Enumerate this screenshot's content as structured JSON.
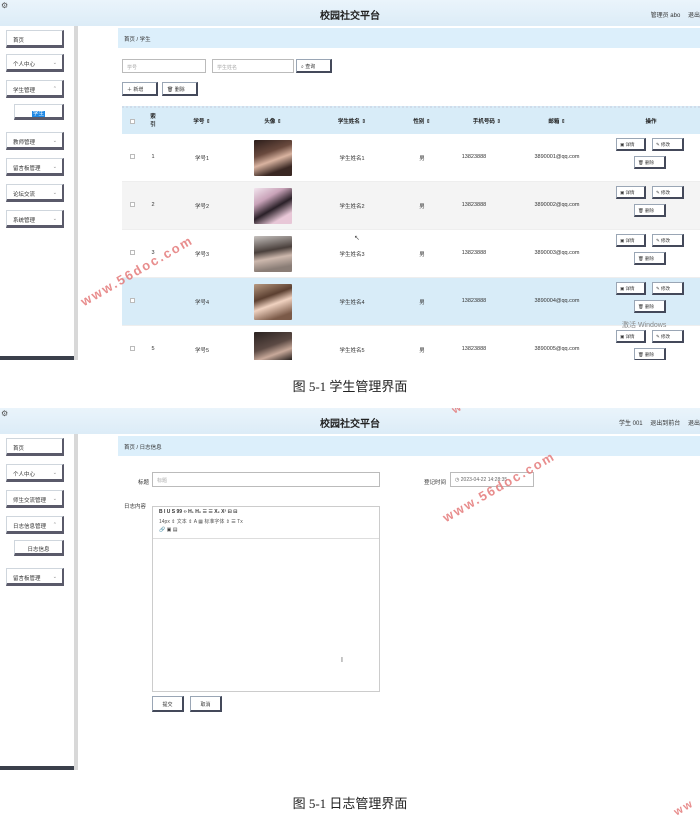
{
  "screen1": {
    "app_title": "校园社交平台",
    "user_label": "管理员 abo",
    "logout_label": "退出",
    "sidebar": [
      {
        "label": "首页",
        "chev": ""
      },
      {
        "label": "个人中心",
        "chev": "⌄"
      },
      {
        "label": "学生管理",
        "chev": "⌃"
      },
      {
        "label": "教师管理",
        "chev": "⌄"
      },
      {
        "label": "留言板管理",
        "chev": "⌄"
      },
      {
        "label": "论坛交流",
        "chev": "⌄"
      },
      {
        "label": "系统管理",
        "chev": "⌄"
      }
    ],
    "sidebar_sub": "学生",
    "breadcrumb": "首页 / 学生",
    "search": {
      "id_placeholder": "学号",
      "name_placeholder": "学生姓名",
      "query_label": "⌕ 查询"
    },
    "add_label": "＋ 新增",
    "delete_label": "🗑 删除",
    "columns": [
      "索\n引",
      "学号 ⇕",
      "头像 ⇕",
      "学生姓名 ⇕",
      "性别 ⇕",
      "手机号码 ⇕",
      "邮箱 ⇕",
      "操作"
    ],
    "rows": [
      {
        "index": "1",
        "id": "学号1",
        "name": "学生姓名1",
        "gender": "男",
        "phone": "13823888",
        "email": "3890001@qq.com"
      },
      {
        "index": "2",
        "id": "学号2",
        "name": "学生姓名2",
        "gender": "男",
        "phone": "13823888",
        "email": "3890002@qq.com"
      },
      {
        "index": "3",
        "id": "学号3",
        "name": "学生姓名3",
        "gender": "男",
        "phone": "13823888",
        "email": "3890003@qq.com"
      },
      {
        "index": "",
        "id": "学号4",
        "name": "学生姓名4",
        "gender": "男",
        "phone": "13823888",
        "email": "3890004@qq.com"
      },
      {
        "index": "5",
        "id": "学号5",
        "name": "学生姓名5",
        "gender": "男",
        "phone": "13823888",
        "email": "3890005@qq.com"
      }
    ],
    "actions": {
      "detail": "▣ 详情",
      "edit": "✎ 修改",
      "remove": "🗑 删除"
    },
    "windows_mark": "激活 Windows"
  },
  "caption1": "图 5-1  学生管理界面",
  "screen2": {
    "app_title": "校园社交平台",
    "user_label": "学生 001",
    "back_label": "退出到前台",
    "logout_label": "退出",
    "sidebar": [
      {
        "label": "首页",
        "chev": ""
      },
      {
        "label": "个人中心",
        "chev": "⌄"
      },
      {
        "label": "师生交流管理",
        "chev": "⌄"
      },
      {
        "label": "日志信息管理",
        "chev": "⌃"
      },
      {
        "label": "留言板管理",
        "chev": "⌄"
      }
    ],
    "sidebar_sub": "日志信息",
    "breadcrumb": "首页 / 日志信息",
    "title_label": "标题",
    "title_placeholder": "标题",
    "time_label": "登记时间",
    "time_value": "◷ 2023-04-22 14:28:35",
    "content_label": "日志内容",
    "toolbar_row1": "B  I  U  S    99  ‹›    H₁  H₂    ☰  ☰    X₂  X²    ⊟  ⊟",
    "toolbar_row2": "14px    ⇕     文本     ⇕     A  ▦     标准字体     ⇕     ☰     Tx",
    "toolbar_row3": "🔗  ▣  ▤",
    "submit_label": "提交",
    "cancel_label": "取消"
  },
  "caption2": "图 5-1  日志管理界面",
  "watermark": "www.56doc.com",
  "watermark_right": "ww"
}
